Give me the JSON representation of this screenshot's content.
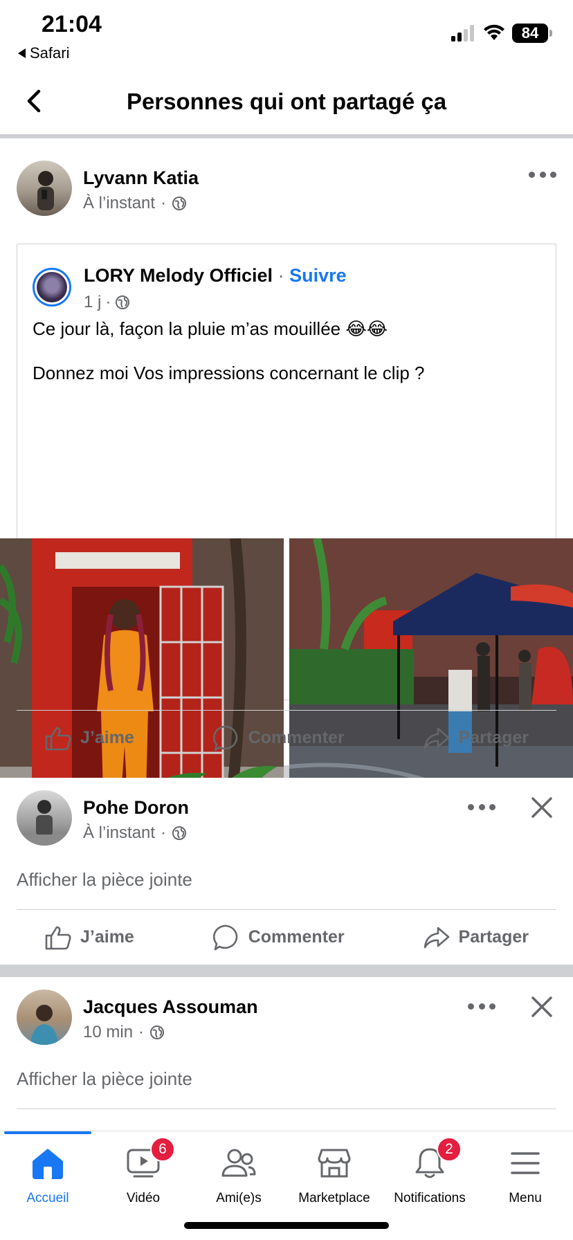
{
  "status_bar": {
    "time": "21:04",
    "back_app": "Safari",
    "battery": "84"
  },
  "header": {
    "title": "Personnes qui ont partagé ça"
  },
  "posts": [
    {
      "author": "Lyvann Katia",
      "time": "À l’instant",
      "shared": {
        "author": "LORY Melody Officiel",
        "separator": "·",
        "follow": "Suivre",
        "time": "1 j",
        "caption_line1": "Ce jour là, façon la pluie m’as mouillée 😂😂",
        "caption_line2": "Donnez moi Vos impressions concernant le clip ?"
      },
      "actions": {
        "like": "J’aime",
        "comment": "Commenter",
        "share": "Partager"
      }
    },
    {
      "author": "Pohe Doron",
      "time": "À l’instant",
      "attachment": "Afficher la pièce jointe",
      "actions": {
        "like": "J’aime",
        "comment": "Commenter",
        "share": "Partager"
      }
    },
    {
      "author": "Jacques Assouman",
      "time": "10 min",
      "attachment": "Afficher la pièce jointe"
    }
  ],
  "meta_separator": "·",
  "tabbar": [
    {
      "label": "Accueil",
      "icon": "home-icon",
      "active": true
    },
    {
      "label": "Vidéo",
      "icon": "video-icon",
      "badge": "6"
    },
    {
      "label": "Ami(e)s",
      "icon": "friends-icon"
    },
    {
      "label": "Marketplace",
      "icon": "marketplace-icon"
    },
    {
      "label": "Notifications",
      "icon": "bell-icon",
      "badge": "2"
    },
    {
      "label": "Menu",
      "icon": "menu-icon"
    }
  ],
  "colors": {
    "accent": "#1877f2",
    "badge": "#e41e3f",
    "muted": "#65676b",
    "divider": "#ced0d4"
  }
}
